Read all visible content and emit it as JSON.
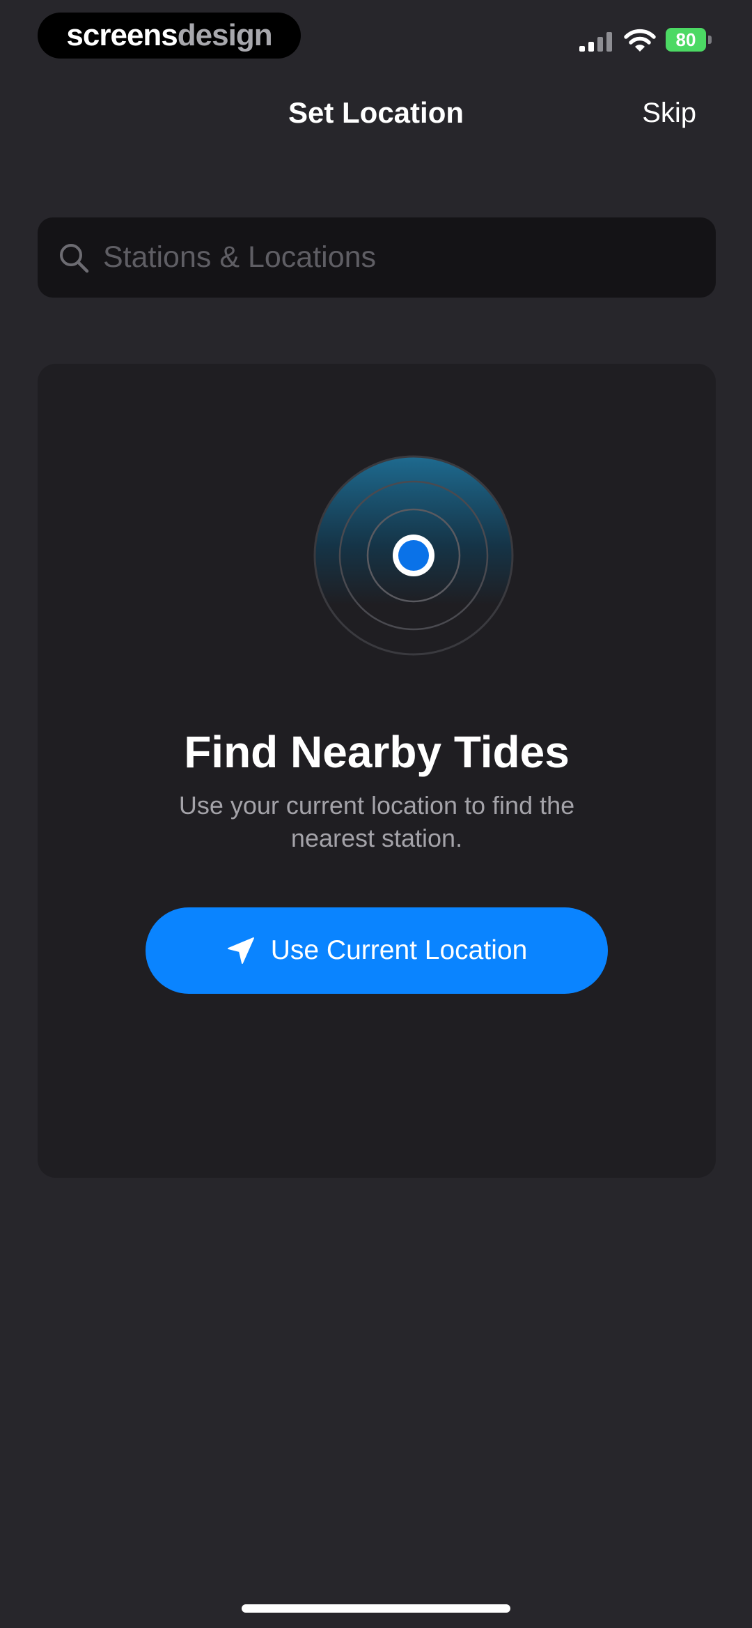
{
  "status_bar": {
    "brand_part1": "screens",
    "brand_part2": "design",
    "battery_level": "80"
  },
  "header": {
    "title": "Set Location",
    "skip_label": "Skip"
  },
  "search": {
    "placeholder": "Stations & Locations"
  },
  "card": {
    "title": "Find Nearby Tides",
    "subtitle": "Use your current location to find the nearest station.",
    "button_label": "Use Current Location",
    "button_icon": "location-arrow-icon",
    "illustration_icon": "radar-icon"
  },
  "colors": {
    "background": "#27262b",
    "card": "#1f1e22",
    "accent": "#0a84ff",
    "battery": "#4cd964"
  }
}
